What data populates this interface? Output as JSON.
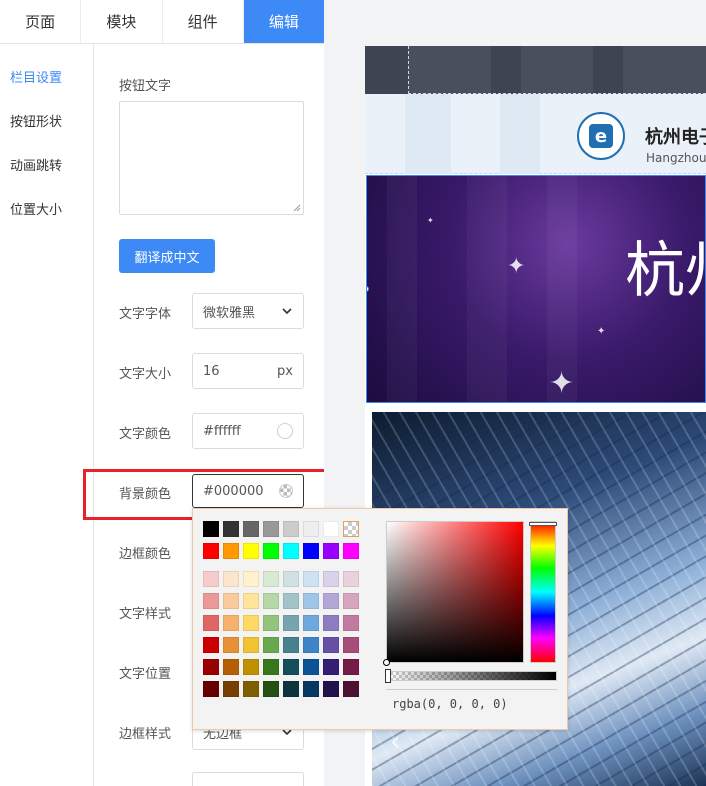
{
  "tabs": [
    {
      "label": "页面"
    },
    {
      "label": "模块"
    },
    {
      "label": "组件"
    },
    {
      "label": "编辑",
      "active": true
    }
  ],
  "sidenav": {
    "items": [
      {
        "label": "栏目设置",
        "active": true
      },
      {
        "label": "按钮形状"
      },
      {
        "label": "动画跳转"
      },
      {
        "label": "位置大小"
      }
    ]
  },
  "form": {
    "button_text_label": "按钮文字",
    "button_text_value": "",
    "translate_button": "翻译成中文",
    "font_family": {
      "label": "文字字体",
      "value": "微软雅黑"
    },
    "font_size": {
      "label": "文字大小",
      "value": "16",
      "unit": "px"
    },
    "text_color": {
      "label": "文字颜色",
      "value": "#ffffff"
    },
    "bg_color": {
      "label": "背景颜色",
      "value": "#000000"
    },
    "border_color": {
      "label": "边框颜色"
    },
    "text_style": {
      "label": "文字样式"
    },
    "text_position": {
      "label": "文字位置"
    },
    "border_style": {
      "label": "边框样式",
      "value": "无边框"
    }
  },
  "color_picker": {
    "swatch_rows": [
      [
        "#000000",
        "#333333",
        "#666666",
        "#999999",
        "#cccccc",
        "#eeeeee",
        "#ffffff",
        "transparent"
      ],
      [
        "#ff0000",
        "#ff9900",
        "#ffff00",
        "#00ff00",
        "#00ffff",
        "#0000ff",
        "#9900ff",
        "#ff00ff"
      ],
      [
        "#f4cccc",
        "#fce5cd",
        "#fff2cc",
        "#d9ead3",
        "#d0e0e3",
        "#cfe2f3",
        "#d9d2e9",
        "#ead1dc"
      ],
      [
        "#ea9999",
        "#f9cb9c",
        "#ffe599",
        "#b6d7a8",
        "#a2c4c9",
        "#9fc5e8",
        "#b4a7d6",
        "#d5a6bd"
      ],
      [
        "#e06666",
        "#f6b26b",
        "#ffd966",
        "#93c47d",
        "#76a5af",
        "#6fa8dc",
        "#8e7cc3",
        "#c27ba0"
      ],
      [
        "#cc0000",
        "#e69138",
        "#f1c232",
        "#6aa84f",
        "#45818e",
        "#3d85c6",
        "#674ea7",
        "#a64d79"
      ],
      [
        "#990000",
        "#b45f06",
        "#bf9000",
        "#38761d",
        "#134f5c",
        "#0b5394",
        "#351c75",
        "#741b47"
      ],
      [
        "#660000",
        "#783f04",
        "#7f6000",
        "#274e13",
        "#0c343d",
        "#073763",
        "#20124d",
        "#4c1130"
      ]
    ],
    "rgba_value": "rgba(0, 0, 0, 0)"
  },
  "preview": {
    "org_name": "杭州电子",
    "org_sub": "Hangzhou",
    "banner_title": "杭州"
  }
}
